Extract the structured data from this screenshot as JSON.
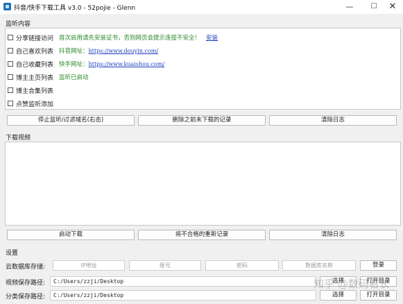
{
  "window": {
    "title": "抖音/快手下载工具 v3.0 - 52pojie - Glenn",
    "minimize_glyph": "—",
    "maximize_glyph": "☐",
    "close_glyph": "✕"
  },
  "monitor": {
    "section_label": "监听内容",
    "checkboxes": [
      {
        "label": "分享链接访问",
        "checked": false
      },
      {
        "label": "自己喜欢列表",
        "checked": false
      },
      {
        "label": "自己收藏列表",
        "checked": false
      },
      {
        "label": "博主主页列表",
        "checked": false
      },
      {
        "label": "博主合集列表",
        "checked": false
      },
      {
        "label": "点赞监听添加",
        "checked": false
      }
    ],
    "log": {
      "line1_text": "首次启用请先安装证书，否则网页会提示连接不安全！",
      "line1_link": "安装",
      "line2_label": "抖音网址：",
      "line2_url": "https://www.douyin.com/",
      "line3_label": "快手网址：",
      "line3_url": "https://www.kuaishou.com/",
      "line4_text": "监听已启动"
    },
    "buttons": {
      "stop": "停止监听/过滤域名(右击)",
      "delete_undownloaded": "删除之前未下载的记录",
      "clear_log": "清除日志"
    }
  },
  "download": {
    "section_label": "下载视频",
    "buttons": {
      "start": "启动下载",
      "redownload": "将不合格的重新记录",
      "clear_log": "清除日志"
    }
  },
  "settings": {
    "section_label": "设置",
    "cloud_label": "云数据库存储:",
    "ip_placeholder": "IP地址",
    "account_placeholder": "账号",
    "password_placeholder": "密码",
    "dbname_placeholder": "数据库名称",
    "login_button": "登录",
    "video_path_label": "视频保存路径:",
    "video_path_value": "C:/Users/zzji/Desktop",
    "category_path_label": "分类保存路径:",
    "category_path_value": "C:/Users/zzji/Desktop",
    "choose_button": "选择",
    "open_dir_button": "打开目录"
  },
  "watermark": {
    "text": "知乎 @数码看长"
  },
  "colors": {
    "log_green": "#2a8a2a",
    "link_blue": "#1c3fbf",
    "window_bg": "#f0f0f0"
  }
}
